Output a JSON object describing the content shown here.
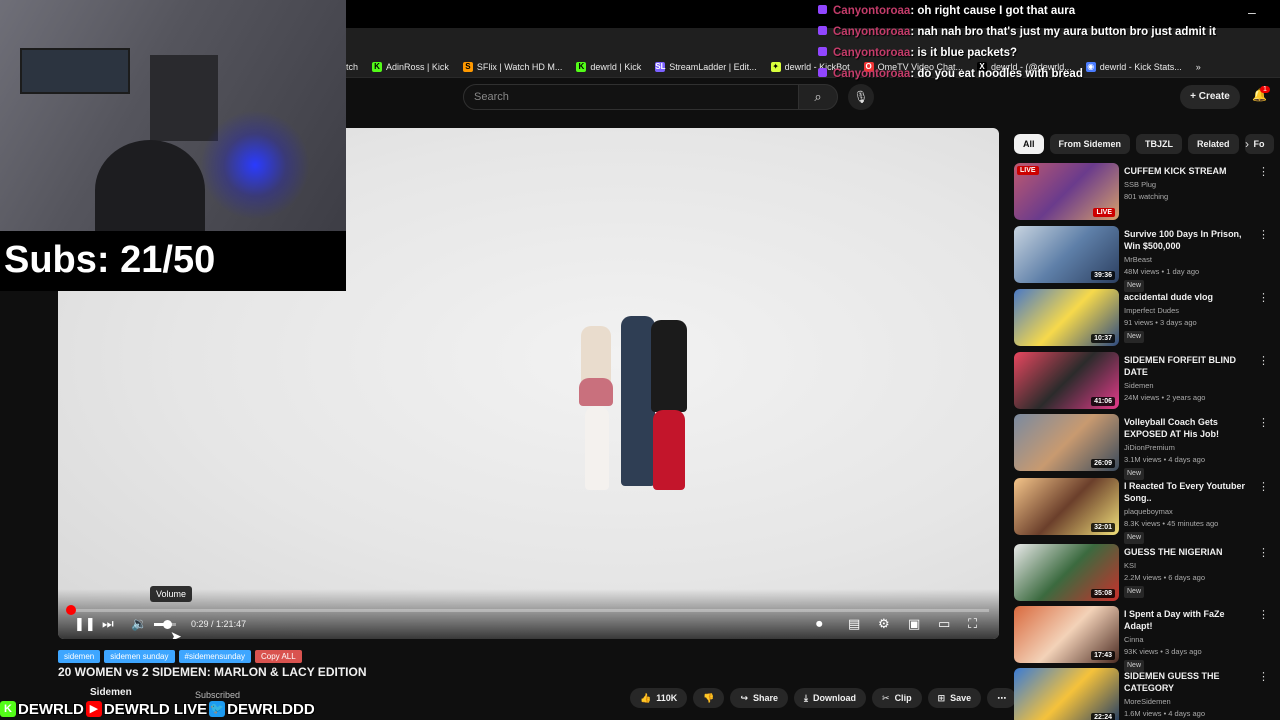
{
  "browser": {
    "bookmarks": [
      {
        "label": "tch",
        "icon_color": "#1f1f1f"
      },
      {
        "label": "AdinRoss | Kick",
        "icon_color": "#53fc18",
        "glyph": "K"
      },
      {
        "label": "SFlix | Watch HD M...",
        "icon_color": "#ff9900",
        "glyph": "S"
      },
      {
        "label": "dewrld | Kick",
        "icon_color": "#53fc18",
        "glyph": "K"
      },
      {
        "label": "StreamLadder | Edit...",
        "icon_color": "#7b61ff",
        "glyph": "SL"
      },
      {
        "label": "dewrld - KickBot",
        "icon_color": "#d8ff3c",
        "glyph": "✦"
      },
      {
        "label": "OmeTV Video Chat...",
        "icon_color": "#e33",
        "glyph": "O"
      },
      {
        "label": "dewrld - (@dewrld...",
        "icon_color": "#000",
        "glyph": "X"
      },
      {
        "label": "dewrld - Kick Stats...",
        "icon_color": "#4a7cff",
        "glyph": "◉"
      }
    ]
  },
  "youtube": {
    "search_placeholder": "Search",
    "create_label": "Create",
    "notification_count": "1"
  },
  "player": {
    "time_current": "0:29",
    "time_total": "1:21:47",
    "tooltip": "Volume",
    "progress": 0.006,
    "volume": 0.6
  },
  "video": {
    "tags": [
      "sidemen",
      "sidemen sunday",
      "#sidemensunday"
    ],
    "copy_label": "Copy ALL",
    "title": "20 WOMEN vs 2 SIDEMEN: MARLON & LACY EDITION",
    "channel": "Sidemen",
    "subscribed": "Subscribed",
    "likes": "110K",
    "share": "Share",
    "download": "Download",
    "clip": "Clip",
    "save": "Save"
  },
  "chips": [
    "All",
    "From Sidemen",
    "TBJZL",
    "Related",
    "Fo"
  ],
  "recommendations": [
    {
      "title": "CUFFEM KICK STREAM",
      "channel": "SSB Plug",
      "meta": "801 watching",
      "badge": "",
      "duration": "LIVE",
      "live": true,
      "thumb": "linear-gradient(135deg,#c05a70,#6a3b8c,#d7a06b)"
    },
    {
      "title": "Survive 100 Days In Prison, Win $500,000",
      "channel": "MrBeast",
      "meta": "48M views • 1 day ago",
      "badge": "New",
      "duration": "39:36",
      "live": false,
      "thumb": "linear-gradient(135deg,#c8d4e0,#5e7fa8,#2c3f60)"
    },
    {
      "title": "accidental dude vlog",
      "channel": "Imperfect Dudes",
      "meta": "91 views • 3 days ago",
      "badge": "New",
      "duration": "10:37",
      "live": false,
      "thumb": "linear-gradient(135deg,#4a79c5,#f6d94b,#2d4a80)"
    },
    {
      "title": "SIDEMEN FORFEIT BLIND DATE",
      "channel": "Sidemen",
      "meta": "24M views • 2 years ago",
      "badge": "",
      "duration": "41:06",
      "live": false,
      "thumb": "linear-gradient(135deg,#e8475f,#2b2b2b,#e43a8a)"
    },
    {
      "title": "Volleyball Coach Gets EXPOSED AT His Job!",
      "channel": "JiDionPremium",
      "meta": "3.1M views • 4 days ago",
      "badge": "New",
      "duration": "26:09",
      "live": false,
      "thumb": "linear-gradient(135deg,#7a8aa0,#c89a70,#3a4a5c)"
    },
    {
      "title": "I Reacted To Every Youtuber Song..",
      "channel": "plaqueboymax",
      "meta": "8.3K views • 45 minutes ago",
      "badge": "New",
      "duration": "32:01",
      "live": false,
      "thumb": "linear-gradient(135deg,#f4c58a,#6b3f2b,#f0e07a)"
    },
    {
      "title": "GUESS THE NIGERIAN",
      "channel": "KSI",
      "meta": "2.2M views • 6 days ago",
      "badge": "New",
      "duration": "35:08",
      "live": false,
      "thumb": "linear-gradient(135deg,#e9e9e9,#3b6a3f,#c9302c)"
    },
    {
      "title": "I Spent a Day with FaZe Adapt!",
      "channel": "Cinna",
      "meta": "93K views • 3 days ago",
      "badge": "New",
      "duration": "17:43",
      "live": false,
      "thumb": "linear-gradient(135deg,#d96a3f,#f3d2b8,#4b2b22)"
    },
    {
      "title": "SIDEMEN GUESS THE CATEGORY",
      "channel": "MoreSidemen",
      "meta": "1.6M views • 4 days ago",
      "badge": "",
      "duration": "22:24",
      "live": false,
      "thumb": "linear-gradient(135deg,#3a7bd5,#f5c23b,#1f3b66)"
    }
  ],
  "overlay": {
    "subs_text": "Subs: 21/50",
    "socials": [
      {
        "label": "DEWRLD",
        "icon": "kick-icon",
        "color": "#53fc18",
        "glyph": "K"
      },
      {
        "label": "DEWRLD LIVE",
        "icon": "youtube-icon",
        "color": "#ff0000",
        "glyph": "▶"
      },
      {
        "label": "DEWRLDDD",
        "icon": "twitter-icon",
        "color": "#1d9bf0",
        "glyph": "🐦"
      }
    ]
  },
  "chat": [
    {
      "user": "Canyontoroaa",
      "message": ": oh right cause I got that aura"
    },
    {
      "user": "Canyontoroaa",
      "message": ": nah nah bro that's just my aura button bro just admit it"
    },
    {
      "user": "Canyontoroaa",
      "message": ": is it blue packets?"
    },
    {
      "user": "Canyontoroaa",
      "message": ": do you eat noodles with bread"
    }
  ]
}
